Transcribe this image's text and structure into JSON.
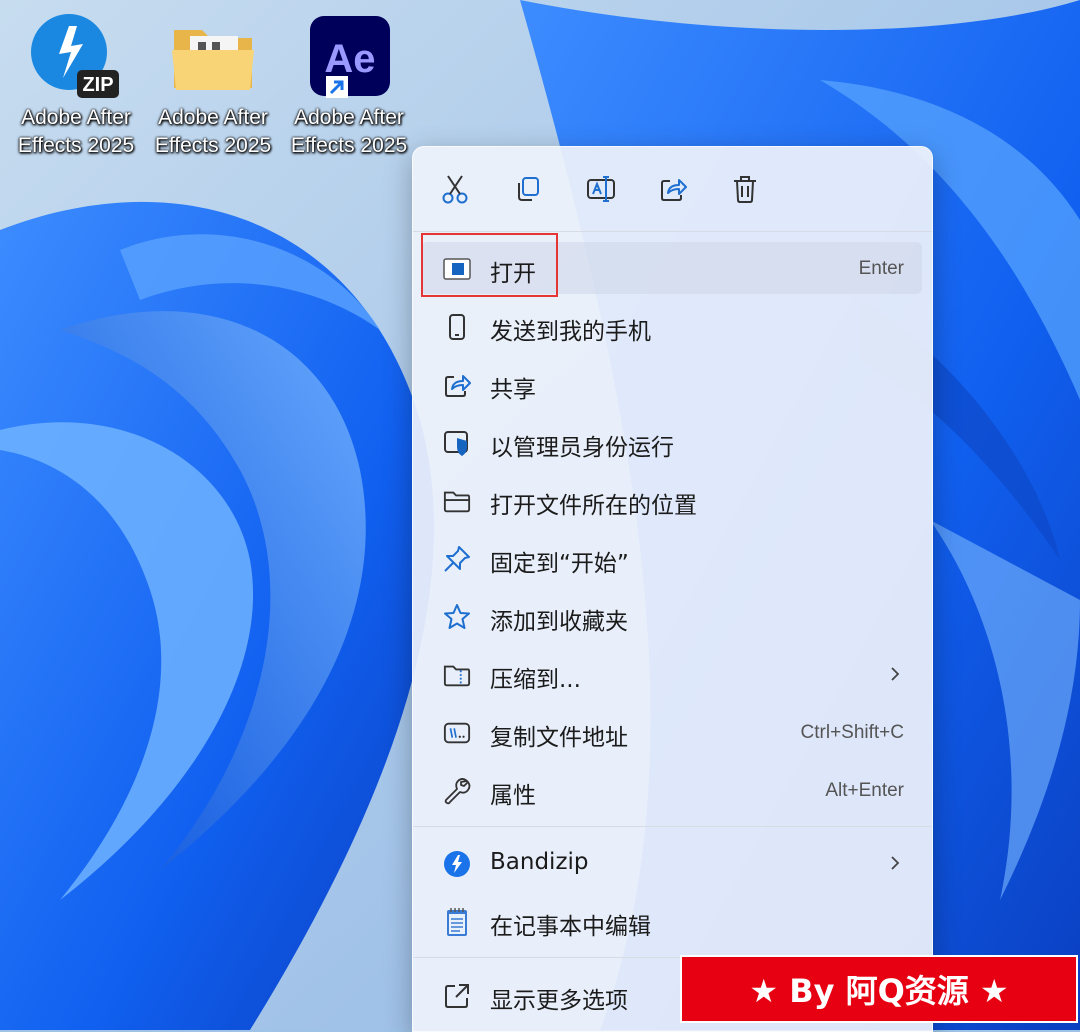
{
  "desktop": {
    "icons": [
      {
        "label_line1": "Adobe After",
        "label_line2": "Effects 2025",
        "type": "zip-archive-icon",
        "badge": "ZIP"
      },
      {
        "label_line1": "Adobe After",
        "label_line2": "Effects 2025",
        "type": "folder-icon"
      },
      {
        "label_line1": "Adobe After",
        "label_line2": "Effects 2025",
        "type": "after-effects-shortcut-icon",
        "app_text": "Ae"
      }
    ]
  },
  "context_menu": {
    "toolbar": [
      "cut-icon",
      "copy-icon",
      "rename-icon",
      "share-icon",
      "delete-icon"
    ],
    "items": [
      {
        "label": "打开",
        "shortcut": "Enter",
        "icon": "open-app-icon",
        "highlighted": true
      },
      {
        "label": "发送到我的手机",
        "shortcut": "",
        "icon": "phone-icon"
      },
      {
        "label": "共享",
        "shortcut": "",
        "icon": "share-icon"
      },
      {
        "label": "以管理员身份运行",
        "shortcut": "",
        "icon": "admin-shield-icon"
      },
      {
        "label": "打开文件所在的位置",
        "shortcut": "",
        "icon": "folder-open-icon"
      },
      {
        "label": "固定到“开始”",
        "shortcut": "",
        "icon": "pin-icon"
      },
      {
        "label": "添加到收藏夹",
        "shortcut": "",
        "icon": "star-icon"
      },
      {
        "label": "压缩到...",
        "shortcut": "",
        "icon": "zip-folder-icon",
        "submenu": true
      },
      {
        "label": "复制文件地址",
        "shortcut": "Ctrl+Shift+C",
        "icon": "copy-path-icon"
      },
      {
        "label": "属性",
        "shortcut": "Alt+Enter",
        "icon": "wrench-icon"
      }
    ],
    "extra_items": [
      {
        "label": "Bandizip",
        "icon": "bandizip-icon",
        "submenu": true
      },
      {
        "label": "在记事本中编辑",
        "icon": "notepad-icon"
      }
    ],
    "more_options": {
      "label": "显示更多选项",
      "icon": "more-options-icon"
    }
  },
  "watermark": {
    "text": "★ By 阿Q资源 ★"
  },
  "colors": {
    "accent": "#0078d4",
    "highlight_border": "#e53535",
    "banner_bg": "#e60012",
    "wallpaper": "#1a6dff"
  }
}
